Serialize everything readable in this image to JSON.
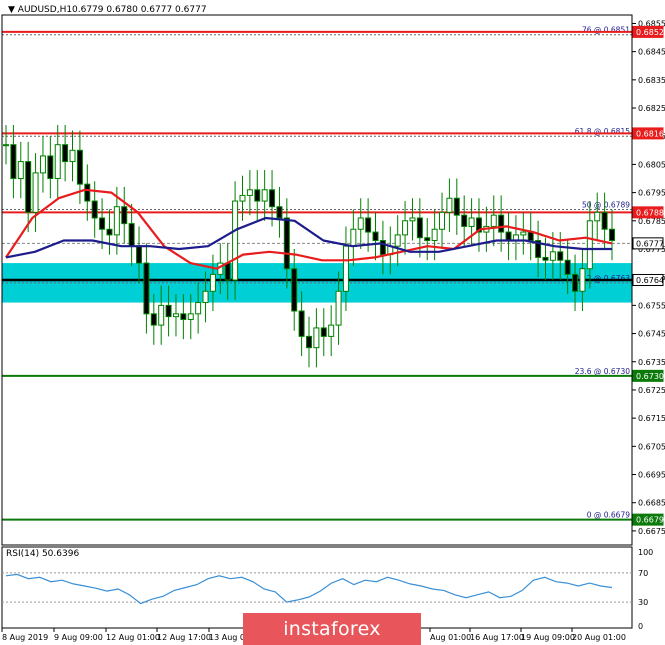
{
  "header": {
    "symbol": "AUDUSD,H1",
    "ohlc": "0.6779 0.6780 0.6777 0.6777"
  },
  "rsi": {
    "label": "RSI(14) 50.6396",
    "levels": [
      "100",
      "70",
      "30",
      "0"
    ]
  },
  "watermark": "instaforex",
  "colors": {
    "support_zone": "#00cfd6",
    "resistance": "#e81c1c",
    "ma_fast": "#e81c1c",
    "ma_slow": "#1c1c8c",
    "level_green": "#0b7a0b",
    "candles": "#008000",
    "rsi_line": "#3a8fd6",
    "price_tag": "#e81c1c",
    "brand": "#e8555a"
  },
  "chart_data": {
    "type": "line",
    "title": "AUDUSD,H1",
    "ylim": [
      0.667,
      0.6858
    ],
    "y_ticks": [
      "0.6855",
      "0.6845",
      "0.6835",
      "0.6825",
      "0.6815",
      "0.6805",
      "0.6795",
      "0.6785",
      "0.6775",
      "0.6765",
      "0.6755",
      "0.6745",
      "0.6735",
      "0.6725",
      "0.6715",
      "0.6705",
      "0.6695",
      "0.6685",
      "0.6675"
    ],
    "x_ticks": [
      "8 Aug 2019",
      "9 Aug 09:00",
      "12 Aug 01:00",
      "12 Aug 17:00",
      "13 Aug 09:00",
      "Aug 01:00",
      "16 Aug 17:00",
      "19 Aug 09:00",
      "20 Aug 01:00"
    ],
    "fib_levels": [
      {
        "label": "76 @ 0.6851",
        "value": 0.6851
      },
      {
        "label": "61.8 @ 0.6815",
        "value": 0.6815
      },
      {
        "label": "50 @ 0.6789",
        "value": 0.6789
      },
      {
        "label": "38.2 @ 0.6763",
        "value": 0.6763
      },
      {
        "label": "23.6 @ 0.6730",
        "value": 0.673
      },
      {
        "label": "0 @ 0.6679",
        "value": 0.6679
      }
    ],
    "price_tags": [
      {
        "label": "0.6852",
        "value": 0.6852,
        "kind": "resistance"
      },
      {
        "label": "0.6816",
        "value": 0.6816,
        "kind": "resistance"
      },
      {
        "label": "0.6788",
        "value": 0.6788,
        "kind": "resistance"
      },
      {
        "label": "0.6777",
        "value": 0.6777,
        "kind": "current"
      },
      {
        "label": "0.6764",
        "value": 0.6764,
        "kind": "pivot"
      },
      {
        "label": "0.6730",
        "value": 0.673,
        "kind": "support"
      },
      {
        "label": "0.6679",
        "value": 0.6679,
        "kind": "support"
      }
    ],
    "support_zone": [
      0.6756,
      0.677
    ],
    "series": [
      {
        "name": "price",
        "values": [
          0.6812,
          0.68,
          0.6806,
          0.6788,
          0.6802,
          0.6808,
          0.68,
          0.6812,
          0.6806,
          0.681,
          0.6798,
          0.6792,
          0.6786,
          0.6782,
          0.678,
          0.679,
          0.6784,
          0.6776,
          0.677,
          0.6752,
          0.6748,
          0.6755,
          0.6751,
          0.6752,
          0.675,
          0.6752,
          0.6756,
          0.676,
          0.6766,
          0.677,
          0.6764,
          0.6792,
          0.6794,
          0.6796,
          0.6792,
          0.6796,
          0.679,
          0.6786,
          0.6768,
          0.6753,
          0.6744,
          0.674,
          0.6747,
          0.6744,
          0.6748,
          0.676,
          0.6776,
          0.6782,
          0.6786,
          0.6781,
          0.6778,
          0.6773,
          0.6776,
          0.678,
          0.6785,
          0.6786,
          0.6779,
          0.6778,
          0.6782,
          0.6788,
          0.6793,
          0.6787,
          0.6783,
          0.6786,
          0.6781,
          0.6783,
          0.6787,
          0.6781,
          0.6778,
          0.678,
          0.6781,
          0.6778,
          0.6772,
          0.6771,
          0.6774,
          0.6771,
          0.6766,
          0.676,
          0.6768,
          0.6785,
          0.6788,
          0.6782,
          0.6778
        ]
      },
      {
        "name": "",
        "values": [
          0.6772,
          0.6786,
          0.6793,
          0.6796,
          0.6795,
          0.6788,
          0.6776,
          0.677,
          0.6768,
          0.6773,
          0.6774,
          0.6773,
          0.6771,
          0.6771,
          0.6772,
          0.6774,
          0.6776,
          0.6775,
          0.6782,
          0.6783,
          0.6781,
          0.6778,
          0.6779,
          0.6777
        ]
      },
      {
        "name": "",
        "values": [
          0.6772,
          0.6774,
          0.6778,
          0.6778,
          0.6776,
          0.6776,
          0.6775,
          0.6776,
          0.6782,
          0.6786,
          0.6785,
          0.6778,
          0.6776,
          0.6777,
          0.6774,
          0.6774,
          0.6776,
          0.6778,
          0.6778,
          0.6776,
          0.6775,
          0.6775
        ]
      },
      {
        "name": "RSI(14)",
        "values": [
          66,
          68,
          62,
          64,
          58,
          60,
          55,
          52,
          49,
          45,
          48,
          40,
          28,
          34,
          38,
          46,
          50,
          54,
          62,
          66,
          62,
          64,
          58,
          48,
          44,
          30,
          33,
          37,
          45,
          56,
          62,
          54,
          60,
          58,
          64,
          60,
          55,
          52,
          48,
          46,
          40,
          36,
          40,
          44,
          36,
          38,
          46,
          60,
          64,
          58,
          56,
          52,
          56,
          52,
          50
        ]
      }
    ]
  }
}
